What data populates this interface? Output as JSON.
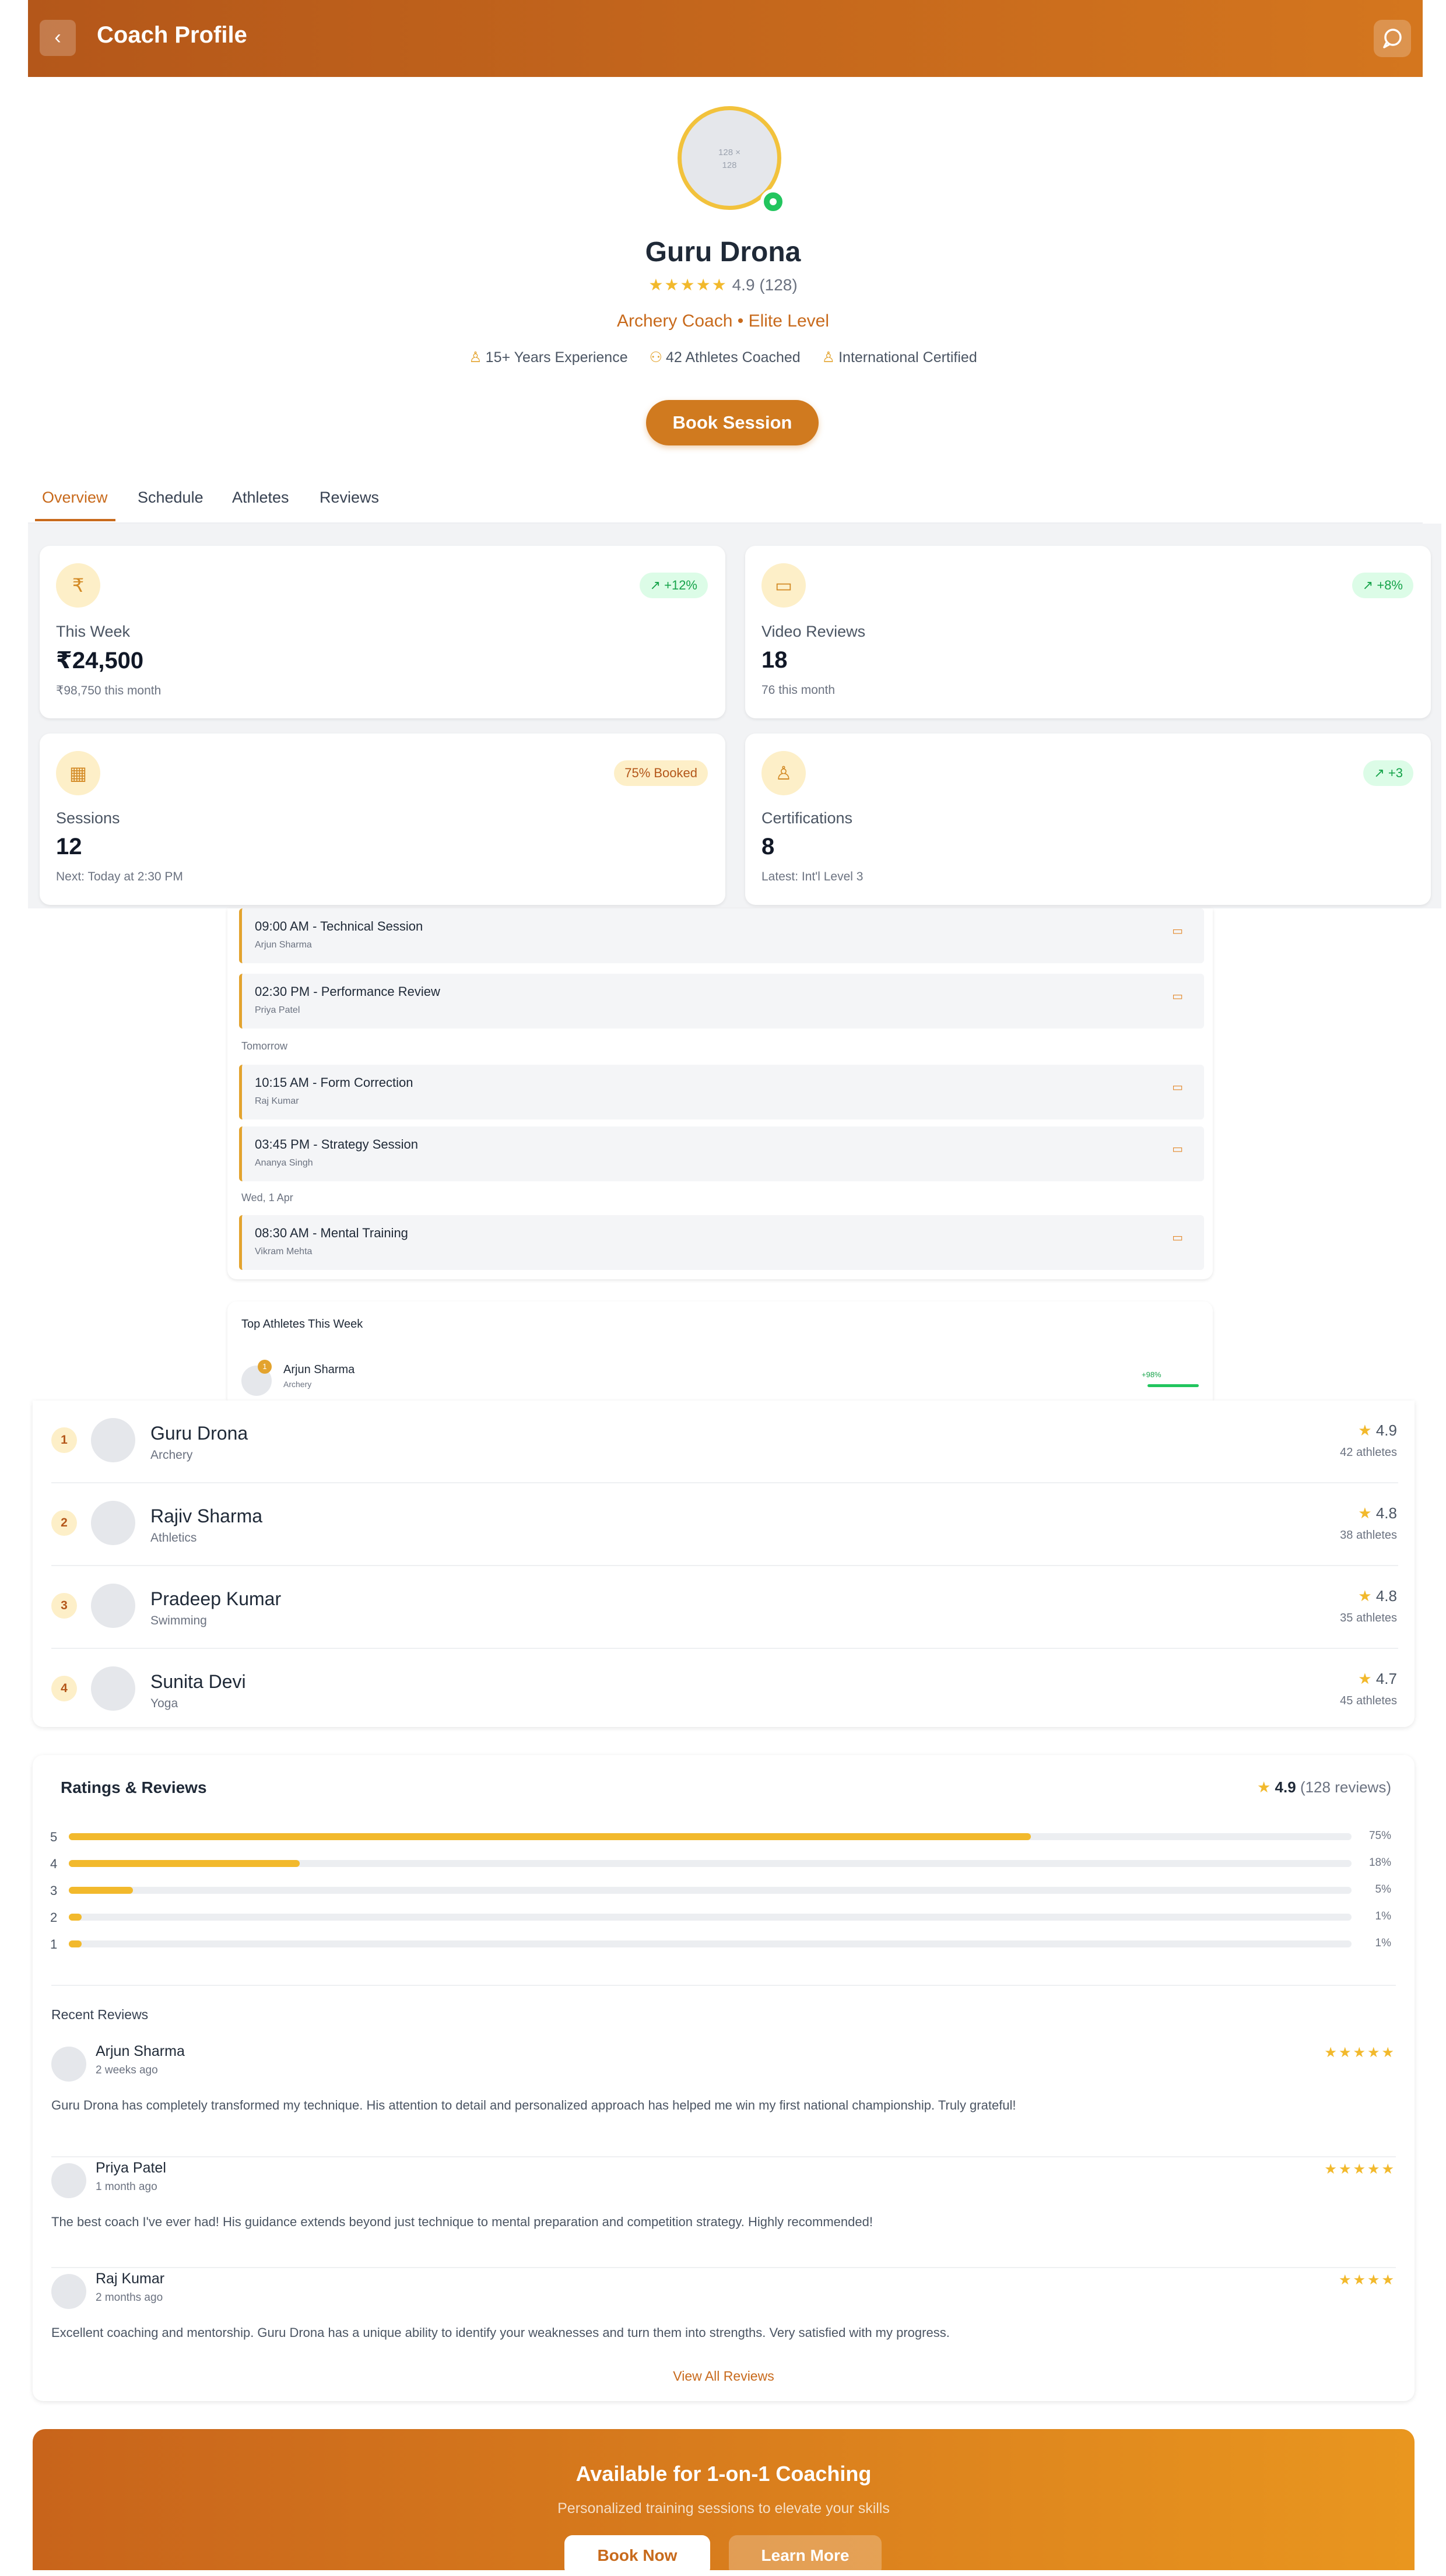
{
  "header": {
    "title": "Coach Profile",
    "back_icon": "‹",
    "chat_icon": "chat-icon"
  },
  "profile": {
    "avatar_text": "128 × 128",
    "name": "Guru Drona",
    "stars": "★★★★★",
    "rating": "4.9 (128)",
    "role": "Archery Coach • Elite Level",
    "meta": [
      "15+ Years Experience",
      "42 Athletes Coached",
      "International Certified"
    ],
    "book_label": "Book Session"
  },
  "tabs": [
    "Overview",
    "Schedule",
    "Athletes",
    "Reviews"
  ],
  "stats": [
    {
      "icon": "₹",
      "badge": "+12%",
      "label": "This Week",
      "value": "₹24,500",
      "sub": "₹98,750 this month"
    },
    {
      "icon": "▭",
      "badge": "+8%",
      "label": "Video Reviews",
      "value": "18",
      "sub": "76 this month"
    },
    {
      "icon": "▦",
      "badge": "75% Booked",
      "label": "Sessions",
      "value": "12",
      "sub": "Next: Today at 2:30 PM"
    },
    {
      "icon": "♙",
      "badge": "+3",
      "label": "Certifications",
      "value": "8",
      "sub": "Latest: Int'l Level 3"
    }
  ],
  "schedule": {
    "items": [
      {
        "title": "09:00 AM - Technical Session",
        "athlete": "Arjun Sharma"
      },
      {
        "title": "02:30 PM - Performance Review",
        "athlete": "Priya Patel"
      },
      {
        "title": "10:15 AM - Form Correction",
        "athlete": "Raj Kumar"
      },
      {
        "title": "03:45 PM - Strategy Session",
        "athlete": "Ananya Singh"
      },
      {
        "title": "08:30 AM - Mental Training",
        "athlete": "Vikram Mehta"
      }
    ],
    "days": [
      "Tomorrow",
      "Wed, 1 Apr"
    ]
  },
  "top_athletes": {
    "title": "Top Athletes This Week",
    "first": {
      "rank": "1",
      "name": "Arjun Sharma",
      "sport": "Archery",
      "change": "+98%"
    }
  },
  "leaderboard": [
    {
      "rank": "1",
      "name": "Guru Drona",
      "sport": "Archery",
      "rating": "4.9",
      "count": "42 athletes"
    },
    {
      "rank": "2",
      "name": "Rajiv Sharma",
      "sport": "Athletics",
      "rating": "4.8",
      "count": "38 athletes"
    },
    {
      "rank": "3",
      "name": "Pradeep Kumar",
      "sport": "Swimming",
      "rating": "4.8",
      "count": "35 athletes"
    },
    {
      "rank": "4",
      "name": "Sunita Devi",
      "sport": "Yoga",
      "rating": "4.7",
      "count": "45 athletes"
    }
  ],
  "ratings": {
    "title": "Ratings & Reviews",
    "score": "4.9",
    "count": "(128 reviews)",
    "bars": [
      {
        "label": "5",
        "pct": "75%",
        "fraction": 0.75
      },
      {
        "label": "4",
        "pct": "18%",
        "fraction": 0.18
      },
      {
        "label": "3",
        "pct": "5%",
        "fraction": 0.05
      },
      {
        "label": "2",
        "pct": "1%",
        "fraction": 0.01
      },
      {
        "label": "1",
        "pct": "1%",
        "fraction": 0.01
      }
    ],
    "recent_title": "Recent Reviews",
    "reviews": [
      {
        "name": "Arjun Sharma",
        "time": "2 weeks ago",
        "stars": "★★★★★",
        "text": "Guru Drona has completely transformed my technique. His attention to detail and personalized approach has helped me win my first national championship. Truly grateful!"
      },
      {
        "name": "Priya Patel",
        "time": "1 month ago",
        "stars": "★★★★★",
        "text": "The best coach I've ever had! His guidance extends beyond just technique to mental preparation and competition strategy. Highly recommended!"
      },
      {
        "name": "Raj Kumar",
        "time": "2 months ago",
        "stars": "★★★★",
        "text": "Excellent coaching and mentorship. Guru Drona has a unique ability to identify your weaknesses and turn them into strengths. Very satisfied with my progress."
      }
    ],
    "view_all": "View All Reviews"
  },
  "cta": {
    "title": "Available for 1-on-1 Coaching",
    "subtitle": "Personalized training sessions to elevate your skills",
    "primary": "Book Now",
    "secondary": "Learn More"
  },
  "colors": {
    "brand": "#c86a1c",
    "accent": "#f2b92c",
    "positive": "#16a34a"
  }
}
